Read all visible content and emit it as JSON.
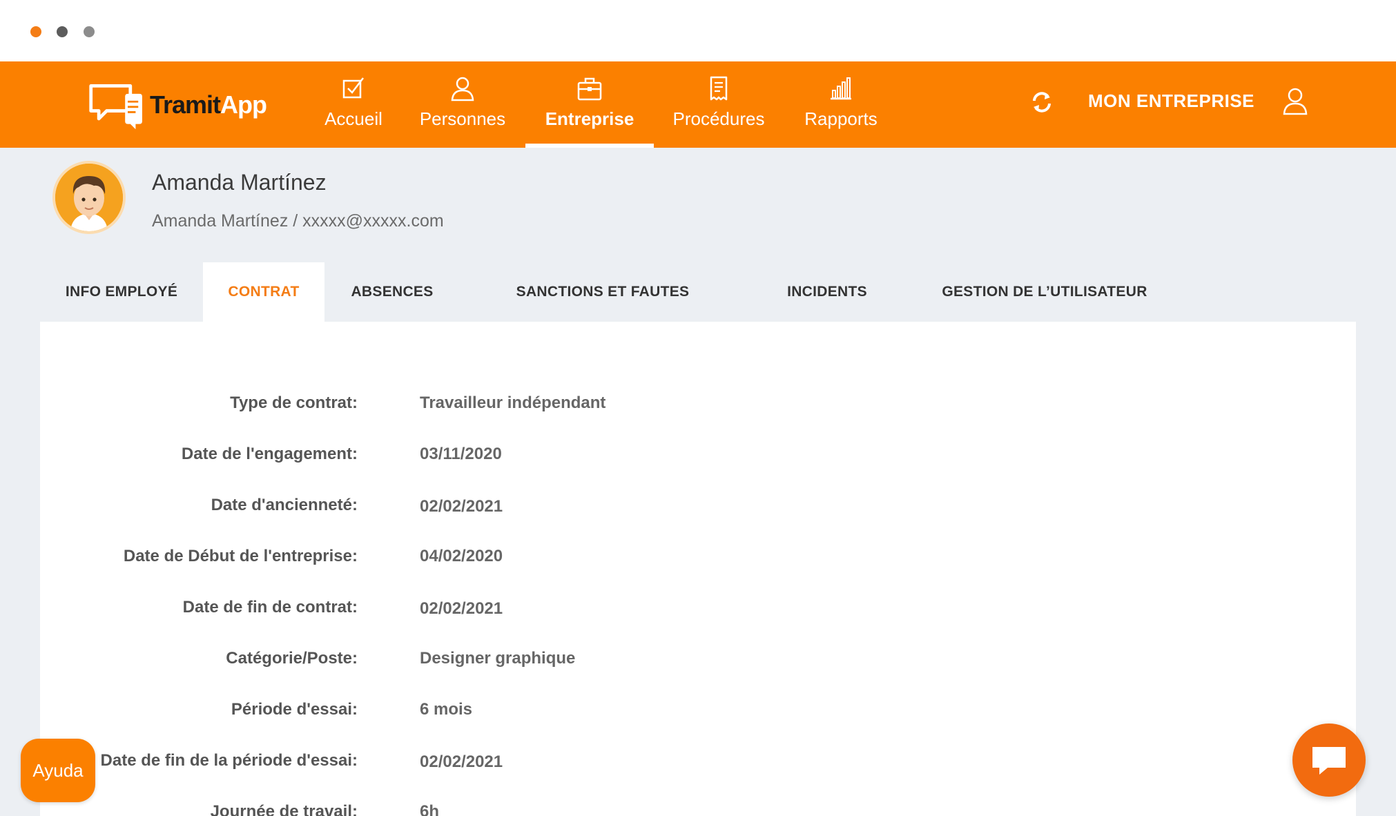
{
  "colors": {
    "brand": "#fb8000",
    "accent_text": "#f47d16",
    "background": "#eceff3"
  },
  "logo": {
    "text_part1": "Tramit",
    "text_part2": "App",
    "icon": "chat-bubbles-logo-icon"
  },
  "nav": {
    "items": [
      {
        "label": "Accueil",
        "icon": "checkbox-icon",
        "active": false
      },
      {
        "label": "Personnes",
        "icon": "person-icon",
        "active": false
      },
      {
        "label": "Entreprise",
        "icon": "briefcase-icon",
        "active": true
      },
      {
        "label": "Procédures",
        "icon": "document-icon",
        "active": false
      },
      {
        "label": "Rapports",
        "icon": "bar-chart-icon",
        "active": false
      }
    ],
    "refresh_icon": "refresh-icon",
    "company_label": "MON ENTREPRISE",
    "user_icon": "user-icon"
  },
  "profile": {
    "name": "Amanda Martínez",
    "subtitle": "Amanda Martínez / xxxxx@xxxxx.com"
  },
  "tabs": [
    {
      "label": "INFO EMPLOYÉ",
      "active": false
    },
    {
      "label": "CONTRAT",
      "active": true
    },
    {
      "label": "ABSENCES",
      "active": false
    },
    {
      "label": "SANCTIONS ET FAUTES",
      "active": false
    },
    {
      "label": "INCIDENTS",
      "active": false
    },
    {
      "label": "GESTION DE L’UTILISATEUR",
      "active": false
    }
  ],
  "contract": {
    "fields": [
      {
        "label": "Type de contrat:",
        "value": "Travailleur indépendant"
      },
      {
        "label": "Date de l'engagement:",
        "value": "03/11/2020"
      },
      {
        "label": "Date d'ancienneté:",
        "value": "02/02/2021"
      },
      {
        "label": "Date de Début de l'entreprise:",
        "value": "04/02/2020"
      },
      {
        "label": "Date de fin de contrat:",
        "value": "02/02/2021"
      },
      {
        "label": "Catégorie/Poste:",
        "value": "Designer graphique"
      },
      {
        "label": "Période d'essai:",
        "value": "6 mois"
      },
      {
        "label": "Date de fin de la période d'essai:",
        "value": "02/02/2021"
      },
      {
        "label": "Journée de travail:",
        "value": "6h"
      }
    ]
  },
  "help": {
    "label": "Ayuda"
  },
  "chat": {
    "icon": "chat-icon"
  }
}
